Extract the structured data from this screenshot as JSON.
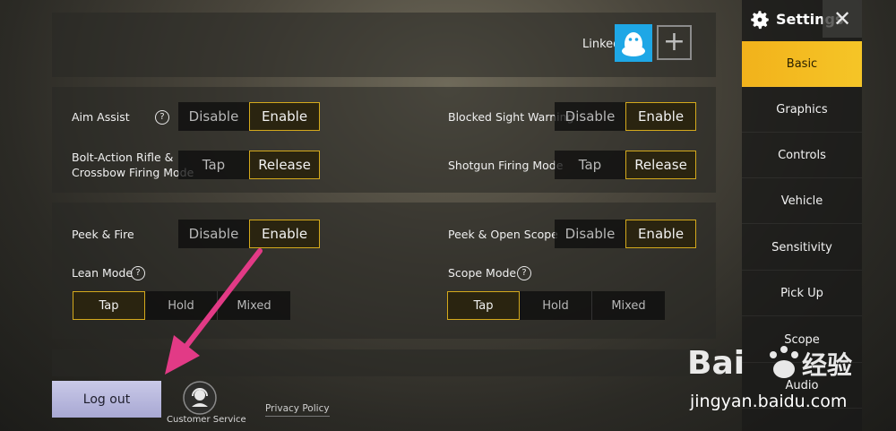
{
  "linked": {
    "label": "Linked"
  },
  "rows1": {
    "aim_assist": {
      "label": "Aim Assist",
      "options": [
        "Disable",
        "Enable"
      ],
      "selected": "Enable"
    },
    "blocked_sight": {
      "label": "Blocked Sight Warning",
      "options": [
        "Disable",
        "Enable"
      ],
      "selected": "Enable"
    },
    "bolt_action": {
      "label": "Bolt-Action Rifle &\nCrossbow Firing Mode",
      "options": [
        "Tap",
        "Release"
      ],
      "selected": "Release"
    },
    "shotgun": {
      "label": "Shotgun Firing Mode",
      "options": [
        "Tap",
        "Release"
      ],
      "selected": "Release"
    }
  },
  "rows2": {
    "peek_fire": {
      "label": "Peek & Fire",
      "options": [
        "Disable",
        "Enable"
      ],
      "selected": "Enable"
    },
    "peek_open": {
      "label": "Peek & Open Scope",
      "options": [
        "Disable",
        "Enable"
      ],
      "selected": "Enable"
    },
    "lean_mode": {
      "label": "Lean Mode",
      "options": [
        "Tap",
        "Hold",
        "Mixed"
      ],
      "selected": "Tap"
    },
    "scope_mode": {
      "label": "Scope Mode",
      "options": [
        "Tap",
        "Hold",
        "Mixed"
      ],
      "selected": "Tap"
    }
  },
  "sidebar": {
    "title": "Settings",
    "close": "✕",
    "items": [
      {
        "label": "Basic",
        "active": true
      },
      {
        "label": "Graphics"
      },
      {
        "label": "Controls"
      },
      {
        "label": "Vehicle"
      },
      {
        "label": "Sensitivity"
      },
      {
        "label": "Pick Up"
      },
      {
        "label": "Scope"
      },
      {
        "label": "Audio"
      }
    ]
  },
  "footer": {
    "logout": "Log out",
    "customer_service": "Customer Service",
    "privacy": "Privacy Policy"
  },
  "watermark": {
    "text": "jingyan.baidu.com"
  },
  "colors": {
    "accent": "#f2b21b",
    "selected_border": "#d4a91c",
    "arrow": "#e23a86",
    "qq_blue": "#1ea7e6"
  }
}
